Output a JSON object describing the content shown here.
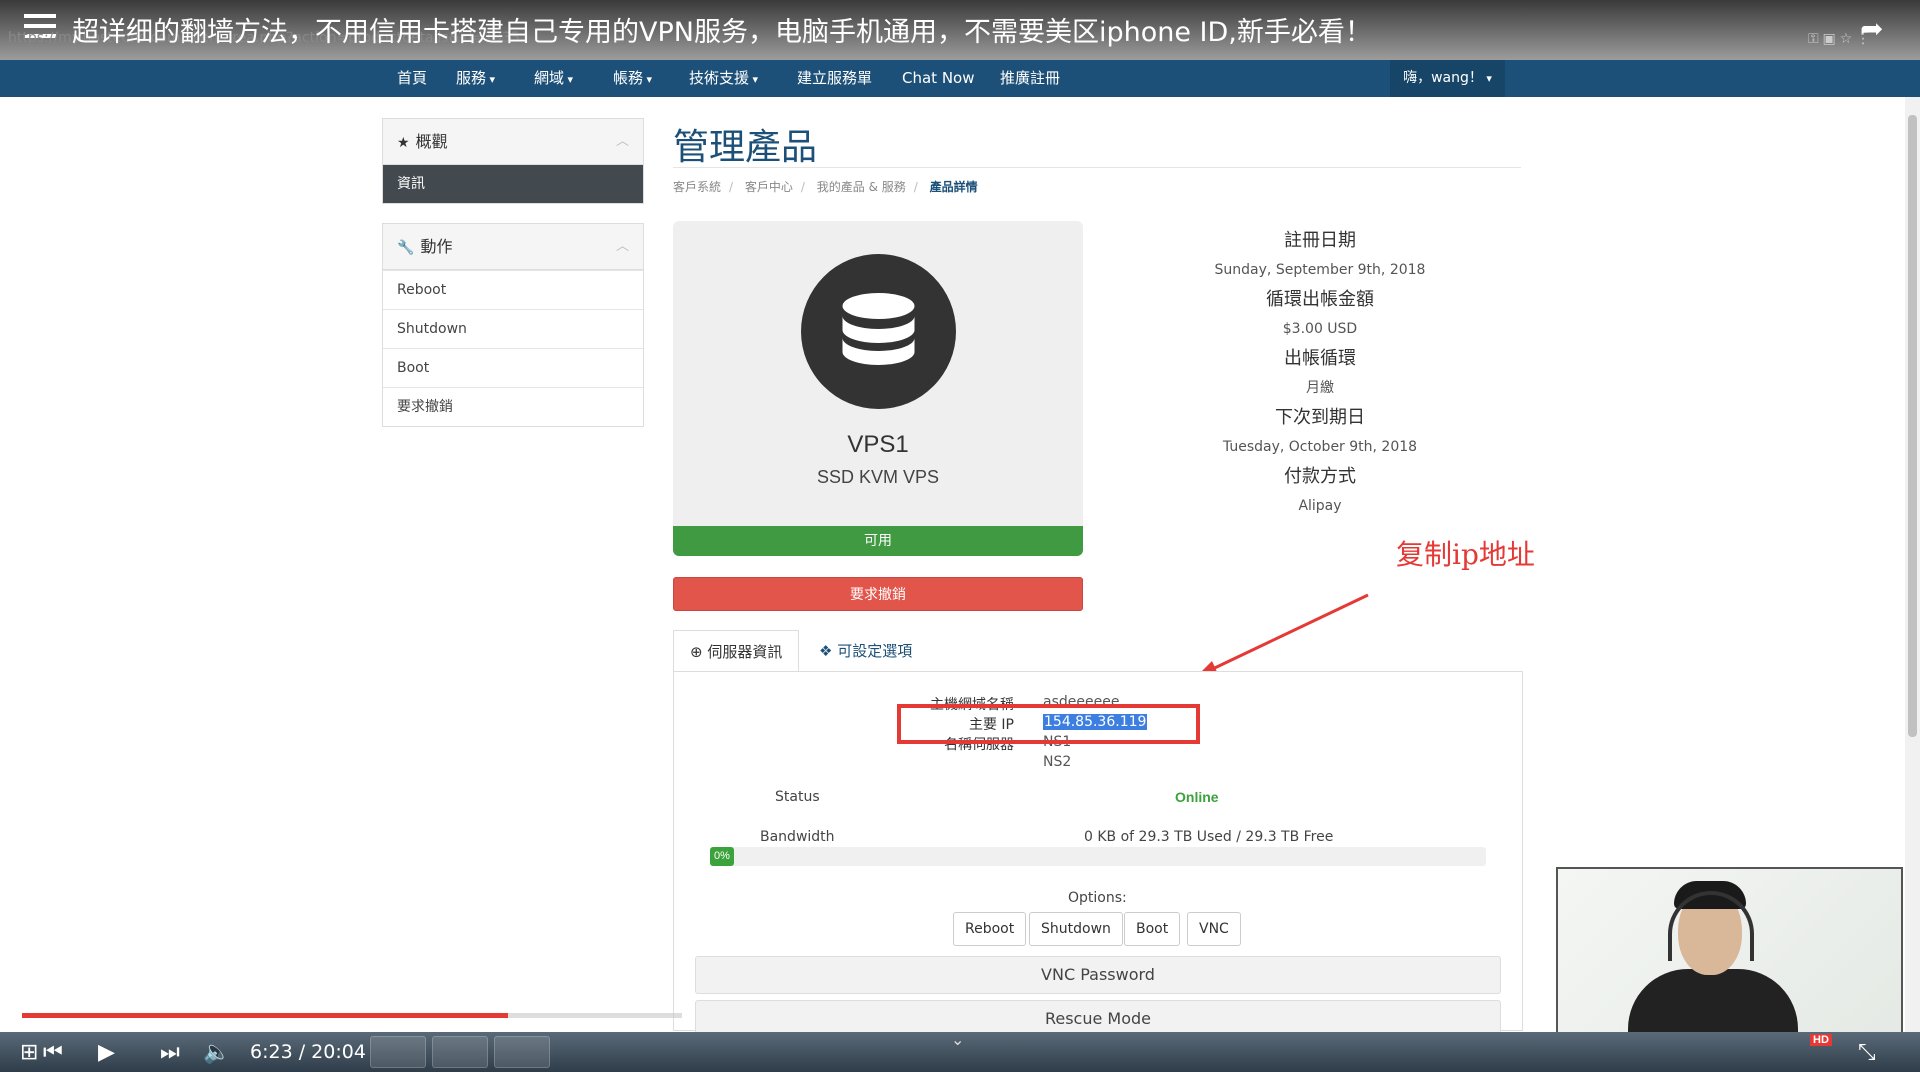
{
  "video": {
    "title": "超详细的翻墙方法，不用信用卡搭建自己专用的VPN服务，电脑手机通用，不需要美区iphone ID,新手必看！",
    "url_fragment": "https://my.hosteons.com/clientarea.php?action=productdetails&id=1935",
    "time": "6:23 / 20:04",
    "progress": 0.736,
    "hd_badge": "HD"
  },
  "nav": {
    "items": [
      "首頁",
      "服務",
      "網域",
      "帳務",
      "技術支援",
      "建立服務單",
      "Chat Now",
      "推廣註冊"
    ],
    "user": "嗨，wang！"
  },
  "sidebar": {
    "overview_title": "概觀",
    "overview_active": "資訊",
    "actions_title": "動作",
    "actions": [
      "Reboot",
      "Shutdown",
      "Boot",
      "要求撤銷"
    ]
  },
  "page": {
    "title": "管理產品",
    "breadcrumb": [
      "客戶系統",
      "客戶中心",
      "我的產品 & 服務",
      "產品詳情"
    ]
  },
  "product": {
    "name": "VPS1",
    "type": "SSD KVM VPS",
    "status": "可用",
    "cancel_label": "要求撤銷"
  },
  "info": {
    "reg_date_label": "註冊日期",
    "reg_date": "Sunday, September 9th, 2018",
    "recurring_label": "循環出帳金額",
    "recurring": "$3.00 USD",
    "cycle_label": "出帳循環",
    "cycle": "月繳",
    "due_label": "下次到期日",
    "due": "Tuesday, October 9th, 2018",
    "payment_label": "付款方式",
    "payment": "Alipay"
  },
  "annotation": "复制ip地址",
  "tabs": [
    "伺服器資訊",
    "可設定選項"
  ],
  "server": {
    "hostname_label": "主機網域名稱",
    "hostname": "asdeeeeee",
    "ip_label": "主要 IP",
    "ip": "154.85.36.119",
    "ns_label": "名稱伺服器",
    "ns1": "NS1",
    "ns2": "NS2",
    "status_label": "Status",
    "status": "Online",
    "bandwidth_label": "Bandwidth",
    "bandwidth": "0 KB of 29.3 TB Used / 29.3 TB Free",
    "bandwidth_pct": "0%",
    "options_label": "Options:",
    "options": [
      "Reboot",
      "Shutdown",
      "Boot",
      "VNC"
    ],
    "vnc_password": "VNC Password",
    "rescue_mode": "Rescue Mode"
  },
  "colors": {
    "nav": "#1d5078",
    "status_green": "#3f9a42",
    "cancel_red": "#e2554a",
    "annotation_red": "#e53935"
  }
}
